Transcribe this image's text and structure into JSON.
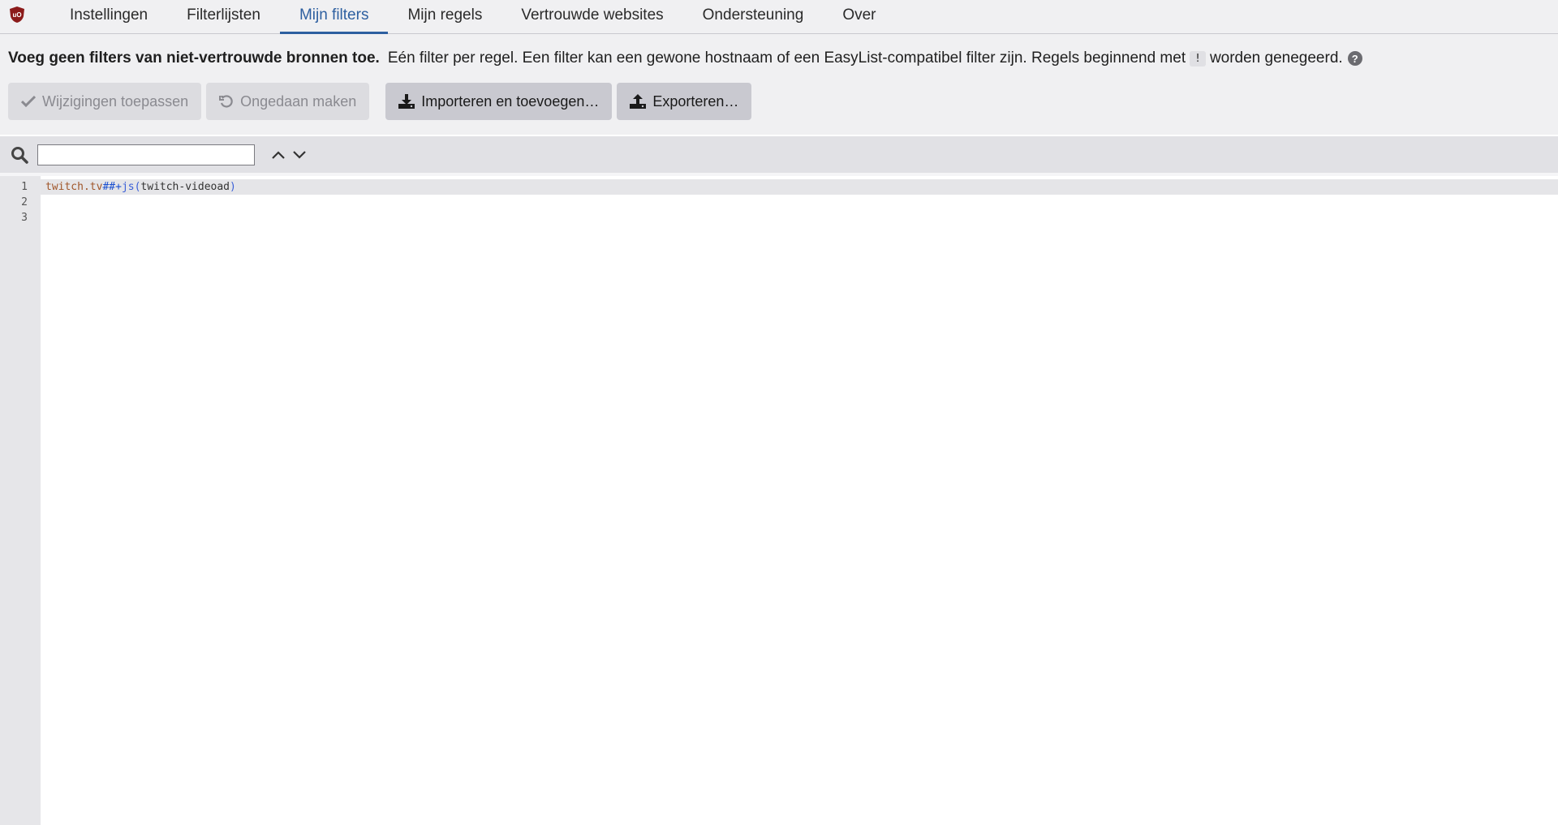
{
  "nav": {
    "tabs": [
      {
        "label": "Instellingen"
      },
      {
        "label": "Filterlijsten"
      },
      {
        "label": "Mijn filters"
      },
      {
        "label": "Mijn regels"
      },
      {
        "label": "Vertrouwde websites"
      },
      {
        "label": "Ondersteuning"
      },
      {
        "label": "Over"
      }
    ],
    "active_tab": "Mijn filters"
  },
  "info": {
    "warning": "Voeg geen filters van niet-vertrouwde bronnen toe.",
    "description_before": "Eén filter per regel. Een filter kan een gewone hostnaam of een EasyList-compatibel filter zijn. Regels beginnend met",
    "code_char": "!",
    "description_after": "worden genegeerd.",
    "help_glyph": "?"
  },
  "buttons": {
    "apply": "Wijzigingen toepassen",
    "undo": "Ongedaan maken",
    "import": "Importeren en toevoegen…",
    "export": "Exporteren…"
  },
  "search": {
    "value": "",
    "placeholder": ""
  },
  "editor": {
    "line_numbers": [
      "1",
      "2",
      "3"
    ],
    "line1": {
      "host": "twitch.tv",
      "sep": "##+",
      "fn": "js(",
      "arg": "twitch-videoad",
      "close": ")"
    }
  },
  "colors": {
    "accent": "#2d5fa0",
    "logo": "#8b1a1a"
  },
  "icons": [
    "ublock-logo-icon",
    "check-icon",
    "undo-icon",
    "download-icon",
    "upload-icon",
    "search-icon",
    "chevron-up-icon",
    "chevron-down-icon",
    "help-icon"
  ]
}
